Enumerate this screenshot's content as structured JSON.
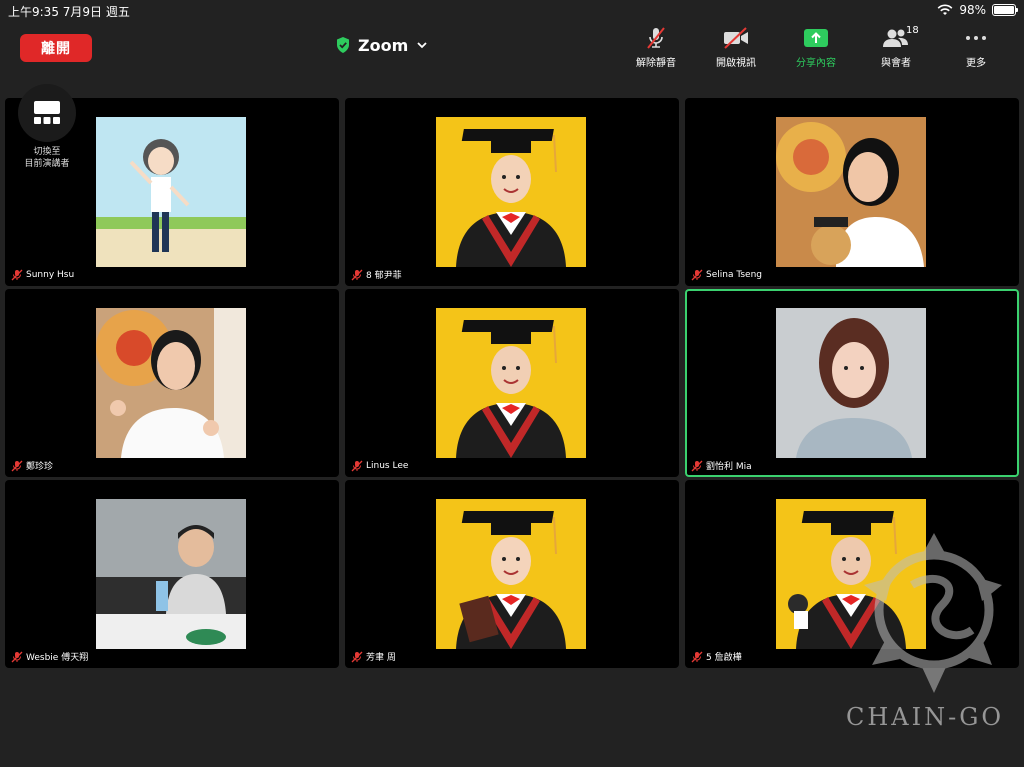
{
  "status_bar": {
    "time": "上午9:35   7月9日 週五",
    "battery": "98%",
    "battery_level": 0.98
  },
  "toolbar": {
    "leave_label": "離開",
    "title": "Zoom",
    "unmute_label": "解除靜音",
    "start_video_label": "開啟視訊",
    "share_label": "分享內容",
    "participants_label": "與會者",
    "participants_count": "18",
    "more_label": "更多"
  },
  "switch_view": {
    "label_line1": "切換至",
    "label_line2": "目前演講者"
  },
  "participants": [
    {
      "name": "Sunny Hsu",
      "photo": "avatar-cartoon",
      "active": false
    },
    {
      "name": "8 郁尹菲",
      "photo": "graduate-girl",
      "active": false
    },
    {
      "name": "Selina Tseng",
      "photo": "teacher-bear",
      "active": false
    },
    {
      "name": "鄭珍珍",
      "photo": "teacher-heart",
      "active": false
    },
    {
      "name": "Linus Lee",
      "photo": "graduate-boy",
      "active": false
    },
    {
      "name": "劉怡利 Mia",
      "photo": "woman-portrait",
      "active": true
    },
    {
      "name": "Wesbie 傅天翔",
      "photo": "boy-table",
      "active": false
    },
    {
      "name": "芳聿 周",
      "photo": "graduate-girl-book",
      "active": false
    },
    {
      "name": "5 詹啟樺",
      "photo": "graduate-boy-bear",
      "active": false
    }
  ],
  "watermark": "CHAIN-GO",
  "colors": {
    "leave": "#e02828",
    "share": "#2ecc5e",
    "active_border": "#3bd16f",
    "muted_mic": "#e53935"
  }
}
